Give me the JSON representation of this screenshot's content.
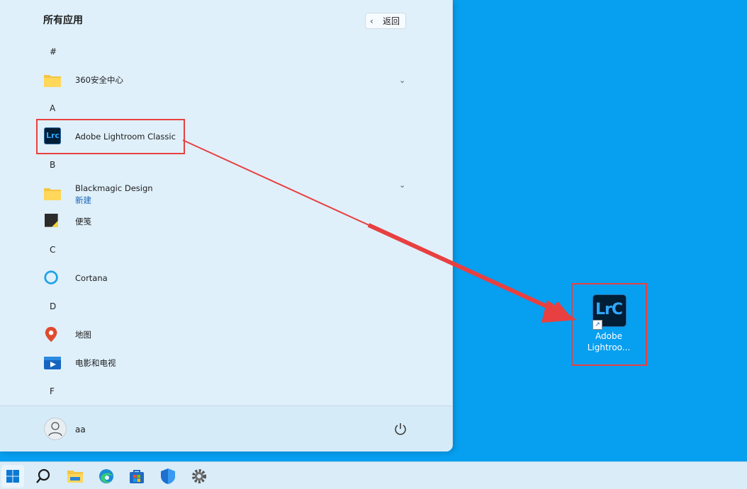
{
  "start_menu": {
    "title": "所有应用",
    "back_label": "返回",
    "sections": [
      {
        "letter": "#"
      },
      {
        "letter": "A"
      },
      {
        "letter": "B"
      },
      {
        "letter": "C"
      },
      {
        "letter": "D"
      },
      {
        "letter": "F"
      }
    ],
    "apps": {
      "app360": {
        "name": "360安全中心"
      },
      "lightroom": {
        "name": "Adobe Lightroom Classic",
        "icon_text": "Lrc"
      },
      "blackmagic": {
        "name": "Blackmagic Design",
        "badge": "新建"
      },
      "sticky": {
        "name": "便笺"
      },
      "cortana": {
        "name": "Cortana"
      },
      "maps": {
        "name": "地图"
      },
      "movies": {
        "name": "电影和电视"
      }
    },
    "user": {
      "name": "aa"
    }
  },
  "desktop": {
    "shortcut_icon_text": "LrC",
    "shortcut_label_line1": "Adobe",
    "shortcut_label_line2": "Lightroo..."
  },
  "colors": {
    "desktop_bg": "#079ff0",
    "highlight": "#e84040",
    "lrc_bg": "#001e36",
    "lrc_text": "#31a8ff"
  },
  "taskbar": {
    "items": [
      "windows-start-icon",
      "search-icon",
      "file-explorer-icon",
      "edge-icon",
      "store-icon",
      "security-icon",
      "settings-icon"
    ]
  }
}
